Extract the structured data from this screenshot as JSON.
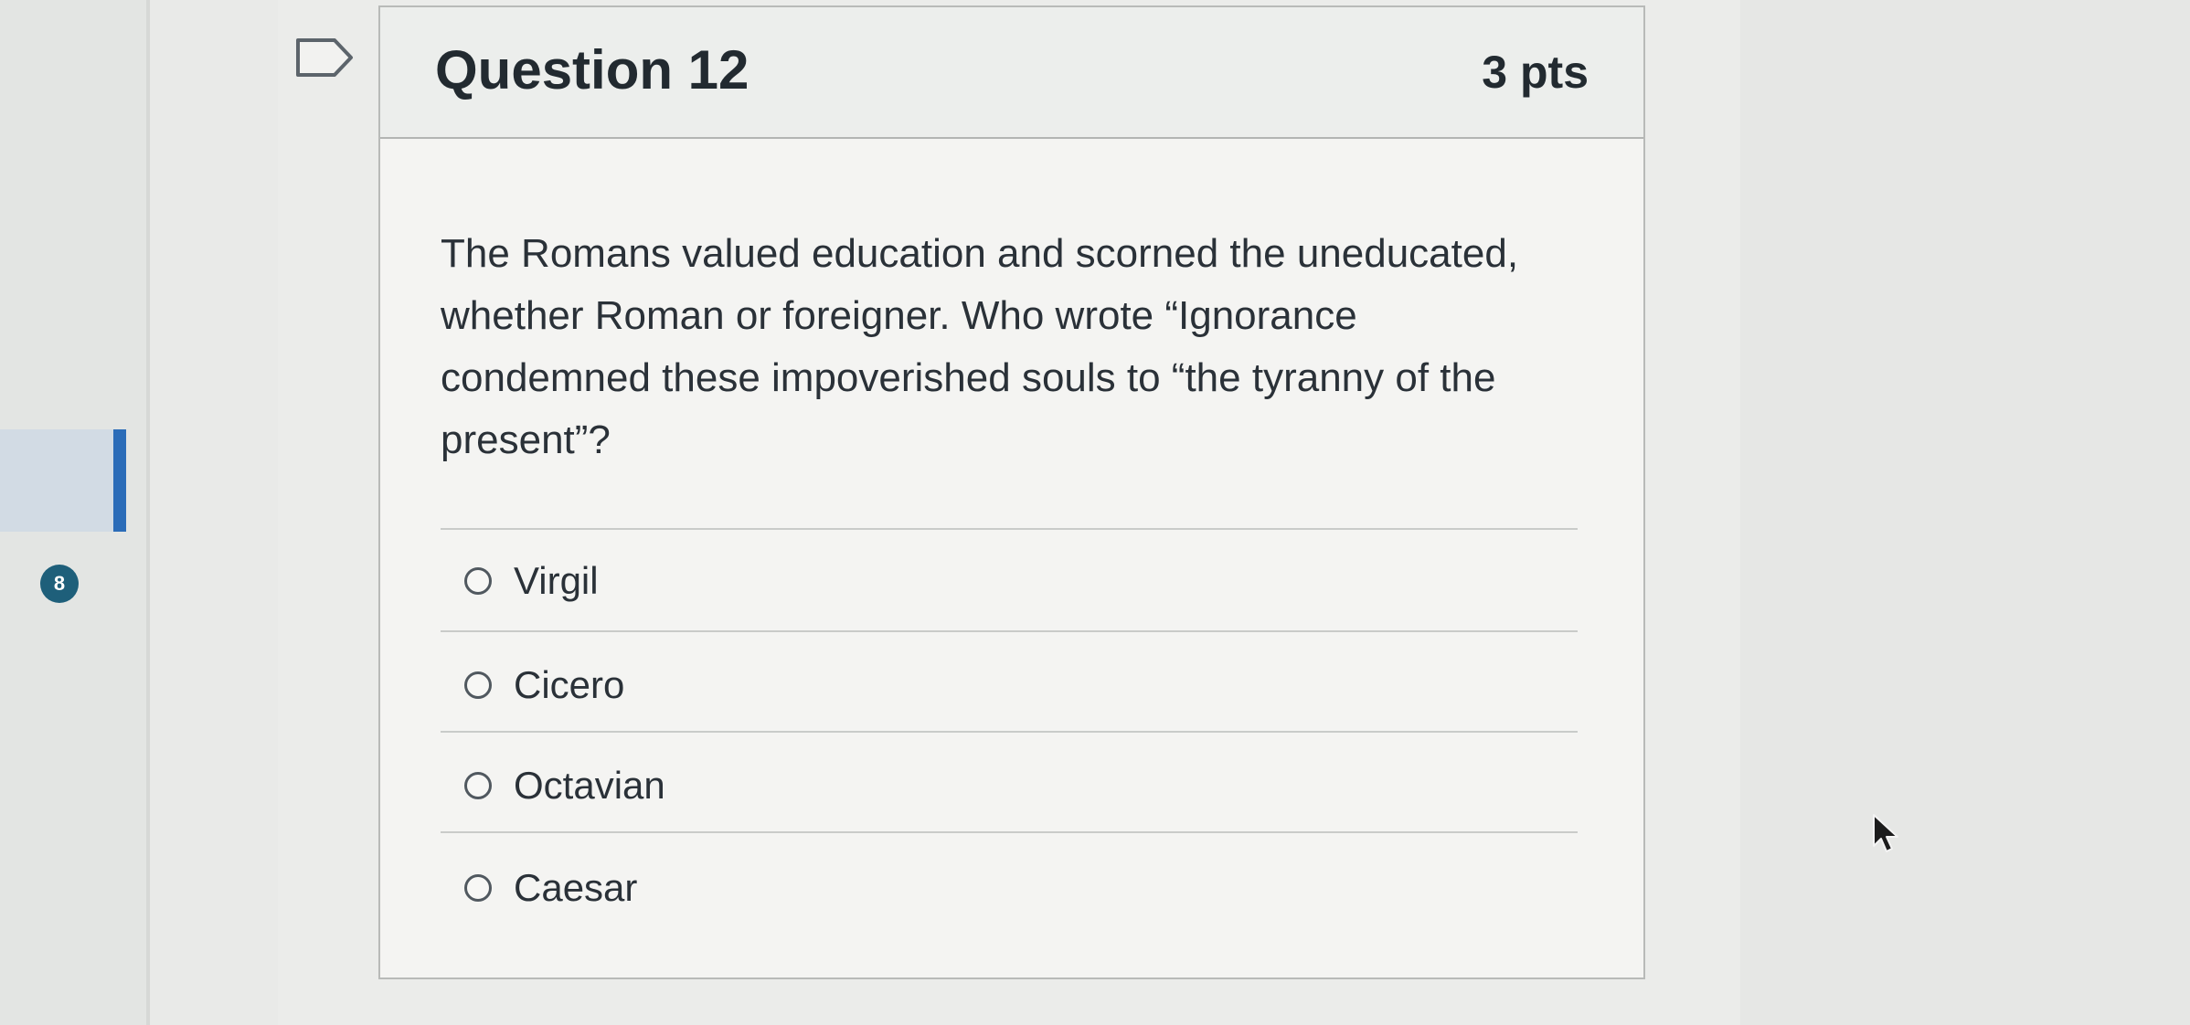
{
  "nav": {
    "badge_count": "8"
  },
  "question": {
    "title": "Question 12",
    "points": "3 pts",
    "text": "The Romans valued education and scorned the uneducated, whether Roman or foreigner.  Who wrote “Ignorance condemned these impoverished souls to “the tyranny of the present”?",
    "options": [
      {
        "label": "Virgil",
        "selected": false
      },
      {
        "label": "Cicero",
        "selected": false
      },
      {
        "label": "Octavian",
        "selected": false
      },
      {
        "label": "Caesar",
        "selected": false
      }
    ]
  },
  "icons": {
    "flag": "flag-icon",
    "cursor": "mouse-pointer-icon",
    "radio": "radio-button"
  },
  "colors": {
    "accent": "#2b6cb8",
    "badge": "#1e5f7a",
    "card_bg": "#f4f4f2"
  }
}
